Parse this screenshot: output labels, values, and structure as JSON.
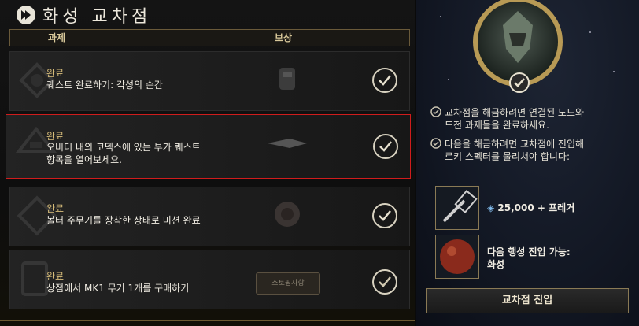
{
  "title": "화성 교차점",
  "header": {
    "task_col": "과제",
    "reward_col": "보상"
  },
  "rows": [
    {
      "status": "완료",
      "desc_1": "퀘스트 완료하기: 각성의 순간",
      "desc_2": "",
      "reward_icon": "armor-icon"
    },
    {
      "status": "완료",
      "desc_1": "오비터 내의 코덱스에 있는 부가 퀘스트",
      "desc_2": "항목을 열어보세요.",
      "reward_icon": "ship-icon"
    },
    {
      "status": "완료",
      "desc_1": "볼터 주무기를 장착한 상태로 미션 완료",
      "desc_2": "",
      "reward_icon": "helmet-icon"
    },
    {
      "status": "완료",
      "desc_1": "상점에서 MK1 무기 1개를 구매하기",
      "desc_2": "",
      "reward_label": "스토핑사항"
    }
  ],
  "right": {
    "info_1_line_1": "교차점을 해금하려면 연결된 노드와",
    "info_1_line_2": "도전 과제들을 완료하세요.",
    "info_2_line_1": "다음을 해금하려면 교차점에 진입해",
    "info_2_line_2": "로키 스펙터를 물리쳐야 합니다:",
    "reward_1": "25,000 + 프레거",
    "reward_2_line_1": "다음 행성 진입 가능:",
    "reward_2_line_2": "화성",
    "enter_button": "교차점 진입"
  },
  "colors": {
    "accent_gold": "#b89a55",
    "status_gold": "#d8bd7a",
    "selection_red": "#d01c1c"
  }
}
